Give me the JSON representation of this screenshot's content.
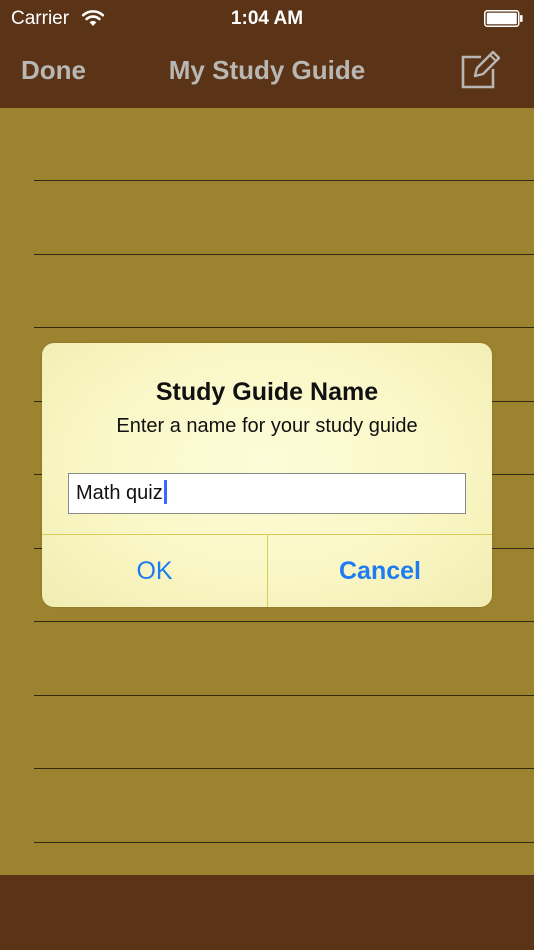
{
  "status_bar": {
    "carrier": "Carrier",
    "time": "1:04 AM",
    "wifi_icon": "wifi-icon",
    "battery_icon": "battery-icon"
  },
  "nav_bar": {
    "done_label": "Done",
    "title": "My Study Guide",
    "compose_icon": "compose-icon"
  },
  "dialog": {
    "title": "Study Guide Name",
    "message": "Enter a name for your study guide",
    "input_value": "Math quiz",
    "ok_label": "OK",
    "cancel_label": "Cancel"
  },
  "colors": {
    "bar_background": "#5b3418",
    "notepad_background": "#9c832f",
    "nav_text": "#b9b7b3",
    "dialog_background": "#faf7c6",
    "button_text": "#1c7cf2",
    "caret": "#3b66ff"
  }
}
